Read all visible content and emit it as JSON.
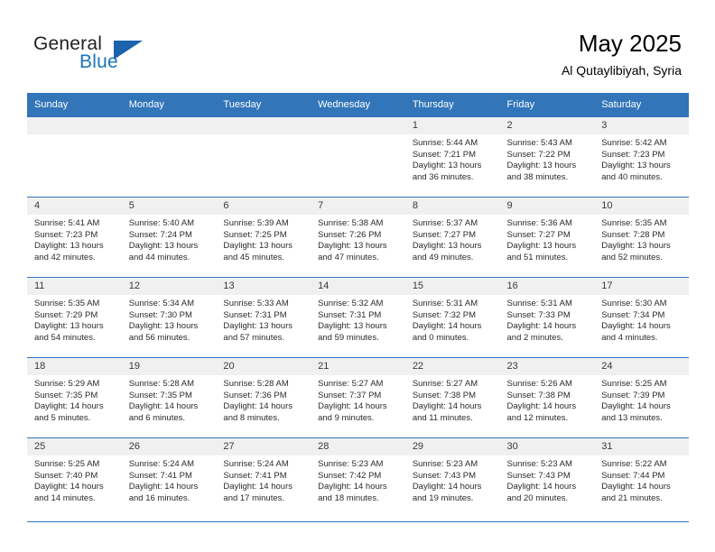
{
  "brand": {
    "name_part1": "General",
    "name_part2": "Blue",
    "accent_color": "#1b75bb",
    "triangle_color": "#1b63ad"
  },
  "header": {
    "title": "May 2025",
    "subtitle": "Al Qutaylibiyah, Syria"
  },
  "theme": {
    "header_row_bg": "#3275b9",
    "daynum_bg": "#f0f0f0",
    "grid_line": "#3275b9"
  },
  "weekday_headers": [
    "Sunday",
    "Monday",
    "Tuesday",
    "Wednesday",
    "Thursday",
    "Friday",
    "Saturday"
  ],
  "weeks": [
    [
      {
        "day": "",
        "info": ""
      },
      {
        "day": "",
        "info": ""
      },
      {
        "day": "",
        "info": ""
      },
      {
        "day": "",
        "info": ""
      },
      {
        "day": "1",
        "info": "Sunrise: 5:44 AM\nSunset: 7:21 PM\nDaylight: 13 hours\nand 36 minutes."
      },
      {
        "day": "2",
        "info": "Sunrise: 5:43 AM\nSunset: 7:22 PM\nDaylight: 13 hours\nand 38 minutes."
      },
      {
        "day": "3",
        "info": "Sunrise: 5:42 AM\nSunset: 7:23 PM\nDaylight: 13 hours\nand 40 minutes."
      }
    ],
    [
      {
        "day": "4",
        "info": "Sunrise: 5:41 AM\nSunset: 7:23 PM\nDaylight: 13 hours\nand 42 minutes."
      },
      {
        "day": "5",
        "info": "Sunrise: 5:40 AM\nSunset: 7:24 PM\nDaylight: 13 hours\nand 44 minutes."
      },
      {
        "day": "6",
        "info": "Sunrise: 5:39 AM\nSunset: 7:25 PM\nDaylight: 13 hours\nand 45 minutes."
      },
      {
        "day": "7",
        "info": "Sunrise: 5:38 AM\nSunset: 7:26 PM\nDaylight: 13 hours\nand 47 minutes."
      },
      {
        "day": "8",
        "info": "Sunrise: 5:37 AM\nSunset: 7:27 PM\nDaylight: 13 hours\nand 49 minutes."
      },
      {
        "day": "9",
        "info": "Sunrise: 5:36 AM\nSunset: 7:27 PM\nDaylight: 13 hours\nand 51 minutes."
      },
      {
        "day": "10",
        "info": "Sunrise: 5:35 AM\nSunset: 7:28 PM\nDaylight: 13 hours\nand 52 minutes."
      }
    ],
    [
      {
        "day": "11",
        "info": "Sunrise: 5:35 AM\nSunset: 7:29 PM\nDaylight: 13 hours\nand 54 minutes."
      },
      {
        "day": "12",
        "info": "Sunrise: 5:34 AM\nSunset: 7:30 PM\nDaylight: 13 hours\nand 56 minutes."
      },
      {
        "day": "13",
        "info": "Sunrise: 5:33 AM\nSunset: 7:31 PM\nDaylight: 13 hours\nand 57 minutes."
      },
      {
        "day": "14",
        "info": "Sunrise: 5:32 AM\nSunset: 7:31 PM\nDaylight: 13 hours\nand 59 minutes."
      },
      {
        "day": "15",
        "info": "Sunrise: 5:31 AM\nSunset: 7:32 PM\nDaylight: 14 hours\nand 0 minutes."
      },
      {
        "day": "16",
        "info": "Sunrise: 5:31 AM\nSunset: 7:33 PM\nDaylight: 14 hours\nand 2 minutes."
      },
      {
        "day": "17",
        "info": "Sunrise: 5:30 AM\nSunset: 7:34 PM\nDaylight: 14 hours\nand 4 minutes."
      }
    ],
    [
      {
        "day": "18",
        "info": "Sunrise: 5:29 AM\nSunset: 7:35 PM\nDaylight: 14 hours\nand 5 minutes."
      },
      {
        "day": "19",
        "info": "Sunrise: 5:28 AM\nSunset: 7:35 PM\nDaylight: 14 hours\nand 6 minutes."
      },
      {
        "day": "20",
        "info": "Sunrise: 5:28 AM\nSunset: 7:36 PM\nDaylight: 14 hours\nand 8 minutes."
      },
      {
        "day": "21",
        "info": "Sunrise: 5:27 AM\nSunset: 7:37 PM\nDaylight: 14 hours\nand 9 minutes."
      },
      {
        "day": "22",
        "info": "Sunrise: 5:27 AM\nSunset: 7:38 PM\nDaylight: 14 hours\nand 11 minutes."
      },
      {
        "day": "23",
        "info": "Sunrise: 5:26 AM\nSunset: 7:38 PM\nDaylight: 14 hours\nand 12 minutes."
      },
      {
        "day": "24",
        "info": "Sunrise: 5:25 AM\nSunset: 7:39 PM\nDaylight: 14 hours\nand 13 minutes."
      }
    ],
    [
      {
        "day": "25",
        "info": "Sunrise: 5:25 AM\nSunset: 7:40 PM\nDaylight: 14 hours\nand 14 minutes."
      },
      {
        "day": "26",
        "info": "Sunrise: 5:24 AM\nSunset: 7:41 PM\nDaylight: 14 hours\nand 16 minutes."
      },
      {
        "day": "27",
        "info": "Sunrise: 5:24 AM\nSunset: 7:41 PM\nDaylight: 14 hours\nand 17 minutes."
      },
      {
        "day": "28",
        "info": "Sunrise: 5:23 AM\nSunset: 7:42 PM\nDaylight: 14 hours\nand 18 minutes."
      },
      {
        "day": "29",
        "info": "Sunrise: 5:23 AM\nSunset: 7:43 PM\nDaylight: 14 hours\nand 19 minutes."
      },
      {
        "day": "30",
        "info": "Sunrise: 5:23 AM\nSunset: 7:43 PM\nDaylight: 14 hours\nand 20 minutes."
      },
      {
        "day": "31",
        "info": "Sunrise: 5:22 AM\nSunset: 7:44 PM\nDaylight: 14 hours\nand 21 minutes."
      }
    ]
  ]
}
